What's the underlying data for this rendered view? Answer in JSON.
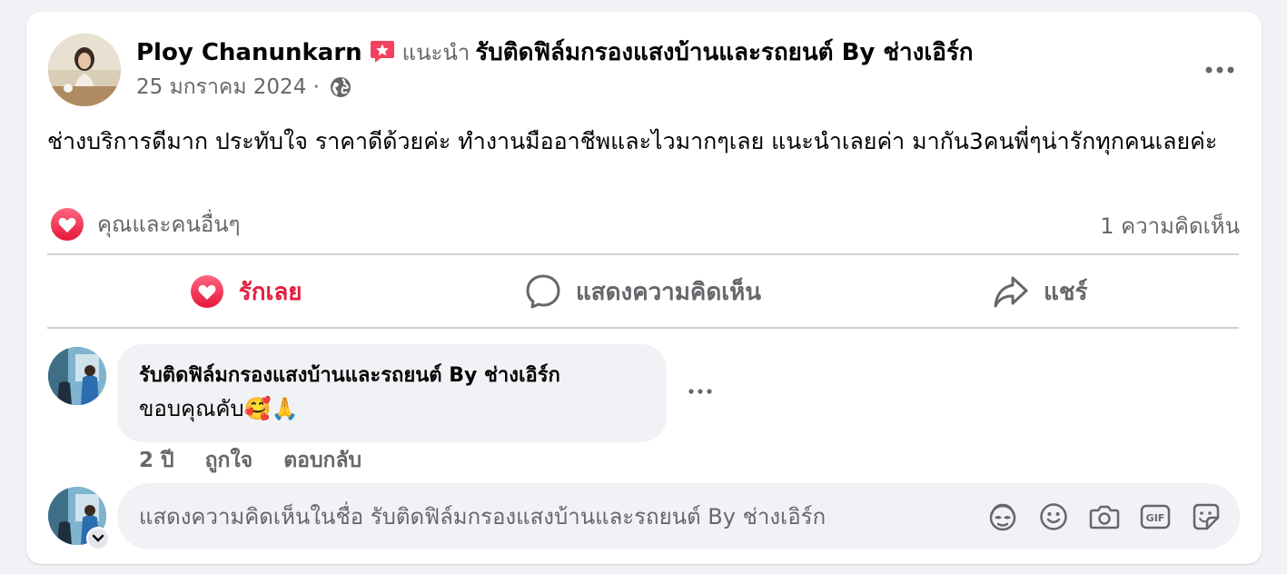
{
  "post": {
    "author_name": "Ploy Chanunkarn",
    "recommends_label": "แนะนำ",
    "page_name": "รับติดฟิล์มกรองแสงบ้านและรถยนต์ By ช่างเอิร์ก",
    "date": "25 มกราคม 2024 ·",
    "body": "ช่างบริการดีมาก ประทับใจ ราคาดีด้วยค่ะ ทำงานมืออาชีพและไวมากๆเลย แนะนำเลยค่า มากัน3คนพี่ๆน่ารักทุกคนเลยค่ะ",
    "reaction_text": "คุณและคนอื่นๆ",
    "comment_count": "1 ความคิดเห็น",
    "icons": {
      "badge": "recommend-star-icon",
      "privacy": "globe-icon",
      "more": "more-horizontal-icon"
    }
  },
  "actions": {
    "love_label": "รักเลย",
    "comment_label": "แสดงความคิดเห็น",
    "share_label": "แชร์"
  },
  "comment": {
    "author": "รับติดฟิล์มกรองแสงบ้านและรถยนต์ By ช่างเอิร์ก",
    "text": "ขอบคุณคับ🥰🙏",
    "time": "2 ปี",
    "like_label": "ถูกใจ",
    "reply_label": "ตอบกลับ"
  },
  "composer": {
    "placeholder": "แสดงความคิดเห็นในชื่อ รับติดฟิล์มกรองแสงบ้านและรถยนต์ By ช่างเอิร์ก",
    "tools": [
      "avatar-sticker-icon",
      "emoji-icon",
      "camera-icon",
      "gif-icon",
      "sticker-icon"
    ]
  },
  "colors": {
    "love": "#e41e3f",
    "secondary_text": "#65676b",
    "background": "#f0f2f5"
  }
}
